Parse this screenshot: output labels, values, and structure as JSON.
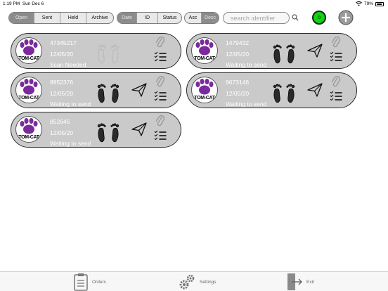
{
  "status_bar": {
    "time": "1:19 PM",
    "date": "Sun Dec 6",
    "battery": "79%"
  },
  "filters": {
    "state_tabs": [
      {
        "label": "Open",
        "active": true
      },
      {
        "label": "Sent",
        "active": false
      },
      {
        "label": "Held",
        "active": false
      },
      {
        "label": "Archive",
        "active": false
      }
    ],
    "sort_field_tabs": [
      {
        "label": "Date",
        "active": true
      },
      {
        "label": "ID",
        "active": false
      },
      {
        "label": "Status",
        "active": false
      }
    ],
    "sort_order_tabs": [
      {
        "label": "Asc",
        "active": false
      },
      {
        "label": "Desc",
        "active": true
      }
    ]
  },
  "search": {
    "placeholder": "search identifier"
  },
  "badge": {
    "count": "0",
    "color": "#12d312"
  },
  "logo": {
    "brand_text": "TOM-CAT",
    "paw_color": "#7a2a9c"
  },
  "orders": [
    {
      "id": "47345217",
      "date": "12/05/20",
      "status": "Scan Needed",
      "feet_state": "faded",
      "send_visible": false
    },
    {
      "id": "1479432",
      "date": "12/05/20",
      "status": "Waiting to send",
      "feet_state": "dark",
      "send_visible": true
    },
    {
      "id": "8952376",
      "date": "12/05/20",
      "status": "Waiting to send",
      "feet_state": "dark",
      "send_visible": true
    },
    {
      "id": "9673146",
      "date": "12/05/20",
      "status": "Waiting to send",
      "feet_state": "dark",
      "send_visible": true
    },
    {
      "id": "852645",
      "date": "12/05/20",
      "status": "Waiting to send",
      "feet_state": "dark",
      "send_visible": true
    }
  ],
  "tab_bar": {
    "orders_label": "Orders",
    "settings_label": "Settings",
    "exit_label": "Exit"
  }
}
